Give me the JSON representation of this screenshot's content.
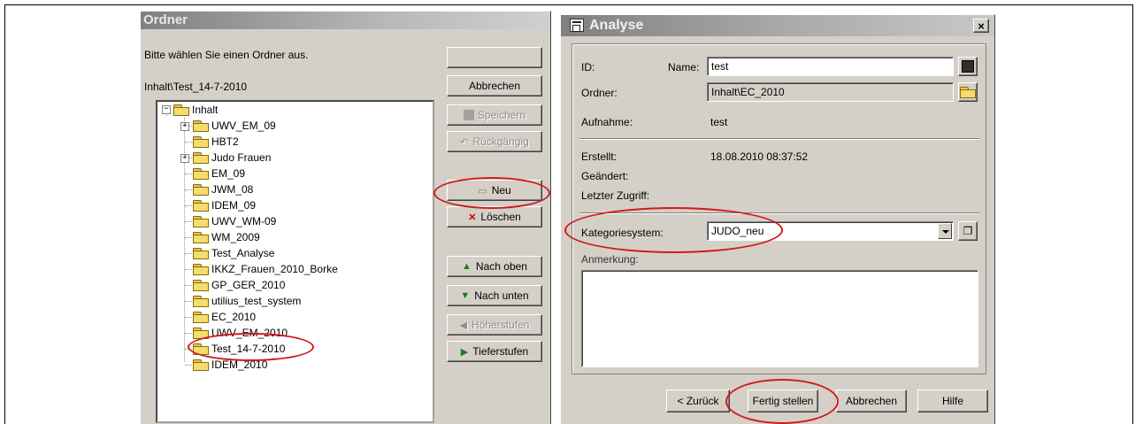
{
  "ordner": {
    "title": "Ordner",
    "prompt": "Bitte wählen Sie einen Ordner aus.",
    "current_path": "Inhalt\\Test_14-7-2010",
    "tree": {
      "root": "Inhalt",
      "items": [
        "UWV_EM_09",
        "HBT2",
        "Judo Frauen",
        "EM_09",
        "JWM_08",
        "IDEM_09",
        "UWV_WM-09",
        "WM_2009",
        "Test_Analyse",
        "IKKZ_Frauen_2010_Borke",
        "GP_GER_2010",
        "utilius_test_system",
        "EC_2010",
        "UWV_EM_2010",
        "Test_14-7-2010",
        "IDEM_2010"
      ]
    },
    "buttons": {
      "top_blank": "",
      "cancel": "Abbrechen",
      "save": "Speichern",
      "undo": "Rückgängig",
      "new": "Neu",
      "delete": "Löschen",
      "up": "Nach oben",
      "down": "Nach unten",
      "promote": "Höherstufen",
      "demote": "Tieferstufen"
    }
  },
  "analyse": {
    "title": "Analyse",
    "close": "×",
    "labels": {
      "id": "ID:",
      "name": "Name:",
      "folder": "Ordner:",
      "recording": "Aufnahme:",
      "created": "Erstellt:",
      "changed": "Geändert:",
      "last_access": "Letzter Zugriff:",
      "category_system": "Kategoriesystem:",
      "remark": "Anmerkung:"
    },
    "values": {
      "name": "test",
      "folder": "Inhalt\\EC_2010",
      "recording": "test",
      "created": "18.08.2010 08:37:52",
      "category_system": "JUDO_neu"
    },
    "buttons": {
      "back": "< Zurück",
      "finish": "Fertig stellen",
      "cancel": "Abbrechen",
      "help": "Hilfe"
    }
  },
  "colors": {
    "dialog_bg": "#d4d0c8",
    "highlight_ring": "#d11a1a",
    "folder_yellow": "#f5dc6e"
  }
}
